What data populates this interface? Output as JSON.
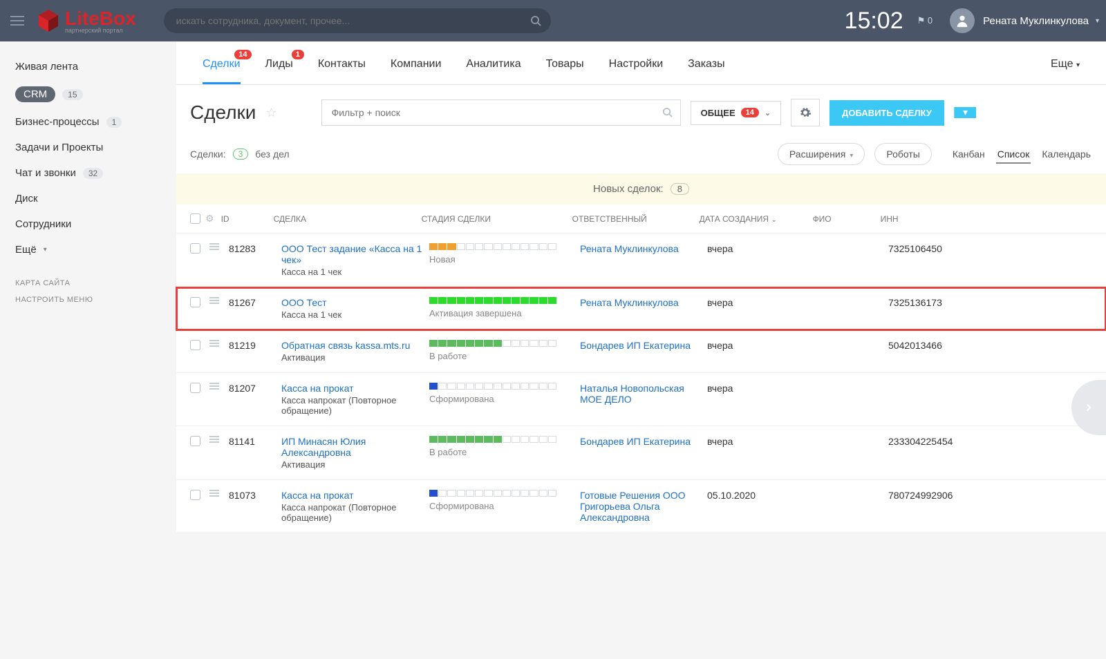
{
  "header": {
    "logo_main": "LiteBox",
    "logo_sub": "партнерский портал",
    "search_placeholder": "искать сотрудника, документ, прочее...",
    "clock": "15:02",
    "flag": "0",
    "username": "Рената Муклинкулова"
  },
  "sidebar": {
    "items": [
      {
        "label": "Живая лента",
        "badge": null
      },
      {
        "label": "CRM",
        "badge": "15",
        "active": true
      },
      {
        "label": "Бизнес-процессы",
        "badge": "1"
      },
      {
        "label": "Задачи и Проекты",
        "badge": null
      },
      {
        "label": "Чат и звонки",
        "badge": "32"
      },
      {
        "label": "Диск",
        "badge": null
      },
      {
        "label": "Сотрудники",
        "badge": null
      },
      {
        "label": "Ещё",
        "badge": null,
        "caret": true
      }
    ],
    "sub1": "КАРТА САЙТА",
    "sub2": "НАСТРОИТЬ МЕНЮ"
  },
  "tabs": [
    {
      "label": "Сделки",
      "badge": "14",
      "active": true
    },
    {
      "label": "Лиды",
      "badge": "1"
    },
    {
      "label": "Контакты"
    },
    {
      "label": "Компании"
    },
    {
      "label": "Аналитика"
    },
    {
      "label": "Товары"
    },
    {
      "label": "Настройки"
    },
    {
      "label": "Заказы"
    },
    {
      "label": "Еще",
      "caret": true
    }
  ],
  "page": {
    "title": "Сделки",
    "filter_placeholder": "Фильтр + поиск",
    "overall_label": "ОБЩЕЕ",
    "overall_badge": "14",
    "add_button": "ДОБАВИТЬ СДЕЛКУ"
  },
  "subbar": {
    "label": "Сделки:",
    "count": "3",
    "nodeal": "без дел",
    "ext": "Расширения",
    "robots": "Роботы",
    "views": [
      "Канбан",
      "Список",
      "Календарь"
    ],
    "active_view": "Список"
  },
  "newbar": {
    "label": "Новых сделок:",
    "count": "8"
  },
  "columns": {
    "id": "ID",
    "deal": "СДЕЛКА",
    "stage": "СТАДИЯ СДЕЛКИ",
    "resp": "ОТВЕТСТВЕННЫЙ",
    "date": "ДАТА СОЗДАНИЯ",
    "fio": "ФИО",
    "inn": "ИНН"
  },
  "rows": [
    {
      "id": "81283",
      "deal": "ООО Тест задание «Касса на 1 чек»",
      "deal_sub": "Касса на 1 чек",
      "stage_label": "Новая",
      "stage_color": "#f0a030",
      "stage_fill": 3,
      "stage_total": 14,
      "resp": "Рената Муклинкулова",
      "date": "вчера",
      "fio": "",
      "inn": "7325106450",
      "highlight": false
    },
    {
      "id": "81267",
      "deal": "ООО Тест",
      "deal_sub": "Касса на 1 чек",
      "stage_label": "Активация завершена",
      "stage_color": "#2bdc2b",
      "stage_fill": 14,
      "stage_total": 14,
      "resp": "Рената Муклинкулова",
      "date": "вчера",
      "fio": "",
      "inn": "7325136173",
      "highlight": true
    },
    {
      "id": "81219",
      "deal": "Обратная связь kassa.mts.ru",
      "deal_sub": "Активация",
      "stage_label": "В работе",
      "stage_color": "#5cbb5c",
      "stage_fill": 8,
      "stage_total": 14,
      "resp": "Бондарев ИП Екатерина",
      "date": "вчера",
      "fio": "",
      "inn": "5042013466",
      "highlight": false
    },
    {
      "id": "81207",
      "deal": "Касса на прокат",
      "deal_sub": "Касса напрокат (Повторное обращение)",
      "stage_label": "Сформирована",
      "stage_color": "#2050d0",
      "stage_fill": 1,
      "stage_total": 14,
      "resp": "Наталья Новопольская МОЕ ДЕЛО",
      "date": "вчера",
      "fio": "",
      "inn": "",
      "highlight": false
    },
    {
      "id": "81141",
      "deal": "ИП Минасян Юлия Александровна",
      "deal_sub": "Активация",
      "stage_label": "В работе",
      "stage_color": "#5cbb5c",
      "stage_fill": 8,
      "stage_total": 14,
      "resp": "Бондарев ИП Екатерина",
      "date": "вчера",
      "fio": "",
      "inn": "233304225454",
      "highlight": false
    },
    {
      "id": "81073",
      "deal": "Касса на прокат",
      "deal_sub": "Касса напрокат (Повторное обращение)",
      "stage_label": "Сформирована",
      "stage_color": "#2050d0",
      "stage_fill": 1,
      "stage_total": 14,
      "resp": "Готовые Решения ООО Григорьева Ольга Александровна",
      "date": "05.10.2020",
      "fio": "",
      "inn": "780724992906",
      "highlight": false
    }
  ]
}
